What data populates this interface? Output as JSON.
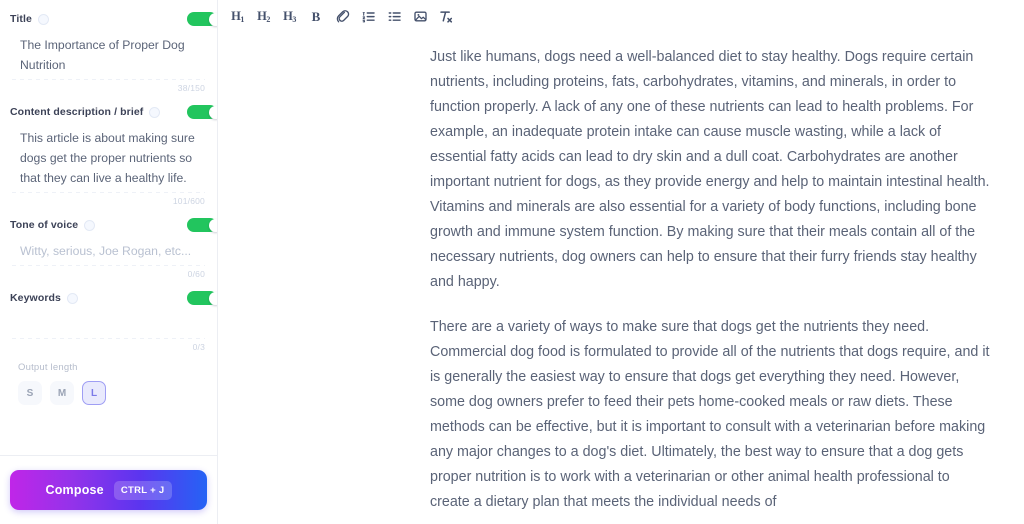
{
  "sidebar": {
    "fields": [
      {
        "label": "Title",
        "info_icon": "info-circle-icon",
        "toggle_on": true,
        "toggle_color": "#22c55e",
        "value": "The Importance of Proper Dog Nutrition",
        "placeholder": "",
        "is_placeholder": false,
        "counter": "38/150"
      },
      {
        "label": "Content description / brief",
        "info_icon": "info-circle-icon",
        "toggle_on": true,
        "toggle_color": "#22c55e",
        "value": "This article is about making sure dogs get the proper nutrients so that they can live a healthy life.",
        "placeholder": "",
        "is_placeholder": false,
        "counter": "101/600"
      },
      {
        "label": "Tone of voice",
        "info_icon": "info-circle-icon",
        "toggle_on": true,
        "toggle_color": "#22c55e",
        "value": "Witty, serious, Joe Rogan, etc...",
        "placeholder": "Witty, serious, Joe Rogan, etc...",
        "is_placeholder": true,
        "counter": "0/60"
      },
      {
        "label": "Keywords",
        "info_icon": "info-circle-icon",
        "toggle_on": true,
        "toggle_color": "#22c55e",
        "value": "",
        "placeholder": "",
        "is_placeholder": true,
        "counter": "0/3"
      }
    ],
    "output_length": {
      "label": "Output length",
      "options": [
        {
          "value": "S",
          "selected": false
        },
        {
          "value": "M",
          "selected": false
        },
        {
          "value": "L",
          "selected": true
        }
      ],
      "selected_value": "L",
      "selected_color": "#9f9ef4"
    },
    "compose": {
      "label": "Compose",
      "shortcut": "CTRL + J",
      "gradient_from": "#c026e8",
      "gradient_to": "#2563f5"
    }
  },
  "editor": {
    "toolbar": [
      {
        "name": "heading-1-button",
        "type": "heading",
        "main": "H",
        "sub": "1"
      },
      {
        "name": "heading-2-button",
        "type": "heading",
        "main": "H",
        "sub": "2"
      },
      {
        "name": "heading-3-button",
        "type": "heading",
        "main": "H",
        "sub": "3"
      },
      {
        "name": "bold-button",
        "type": "bold",
        "main": "B",
        "sub": ""
      },
      {
        "name": "link-button",
        "type": "link",
        "main": "",
        "sub": ""
      },
      {
        "name": "ordered-list-button",
        "type": "ordered-list",
        "main": "",
        "sub": ""
      },
      {
        "name": "unordered-list-button",
        "type": "unordered-list",
        "main": "",
        "sub": ""
      },
      {
        "name": "image-button",
        "type": "image",
        "main": "",
        "sub": ""
      },
      {
        "name": "clear-formatting-button",
        "type": "clear-format",
        "main": "",
        "sub": ""
      }
    ],
    "document": {
      "paragraphs": [
        "Just like humans, dogs need a well-balanced diet to stay healthy. Dogs require certain nutrients, including proteins, fats, carbohydrates, vitamins, and minerals, in order to function properly. A lack of any one of these nutrients can lead to health problems. For example, an inadequate protein intake can cause muscle wasting, while a lack of essential fatty acids can lead to dry skin and a dull coat. Carbohydrates are another important nutrient for dogs, as they provide energy and help to maintain intestinal health. Vitamins and minerals are also essential for a variety of body functions, including bone growth and immune system function. By making sure that their meals contain all of the necessary nutrients, dog owners can help to ensure that their furry friends stay healthy and happy.",
        "There are a variety of ways to make sure that dogs get the nutrients they need. Commercial dog food is formulated to provide all of the nutrients that dogs require, and it is generally the easiest way to ensure that dogs get everything they need. However, some dog owners prefer to feed their pets home-cooked meals or raw diets. These methods can be effective, but it is important to consult with a veterinarian before making any major changes to a dog's diet. Ultimately, the best way to ensure that a dog gets proper nutrition is to work with a veterinarian or other animal health professional to create a dietary plan that meets the individual needs of"
      ]
    }
  }
}
